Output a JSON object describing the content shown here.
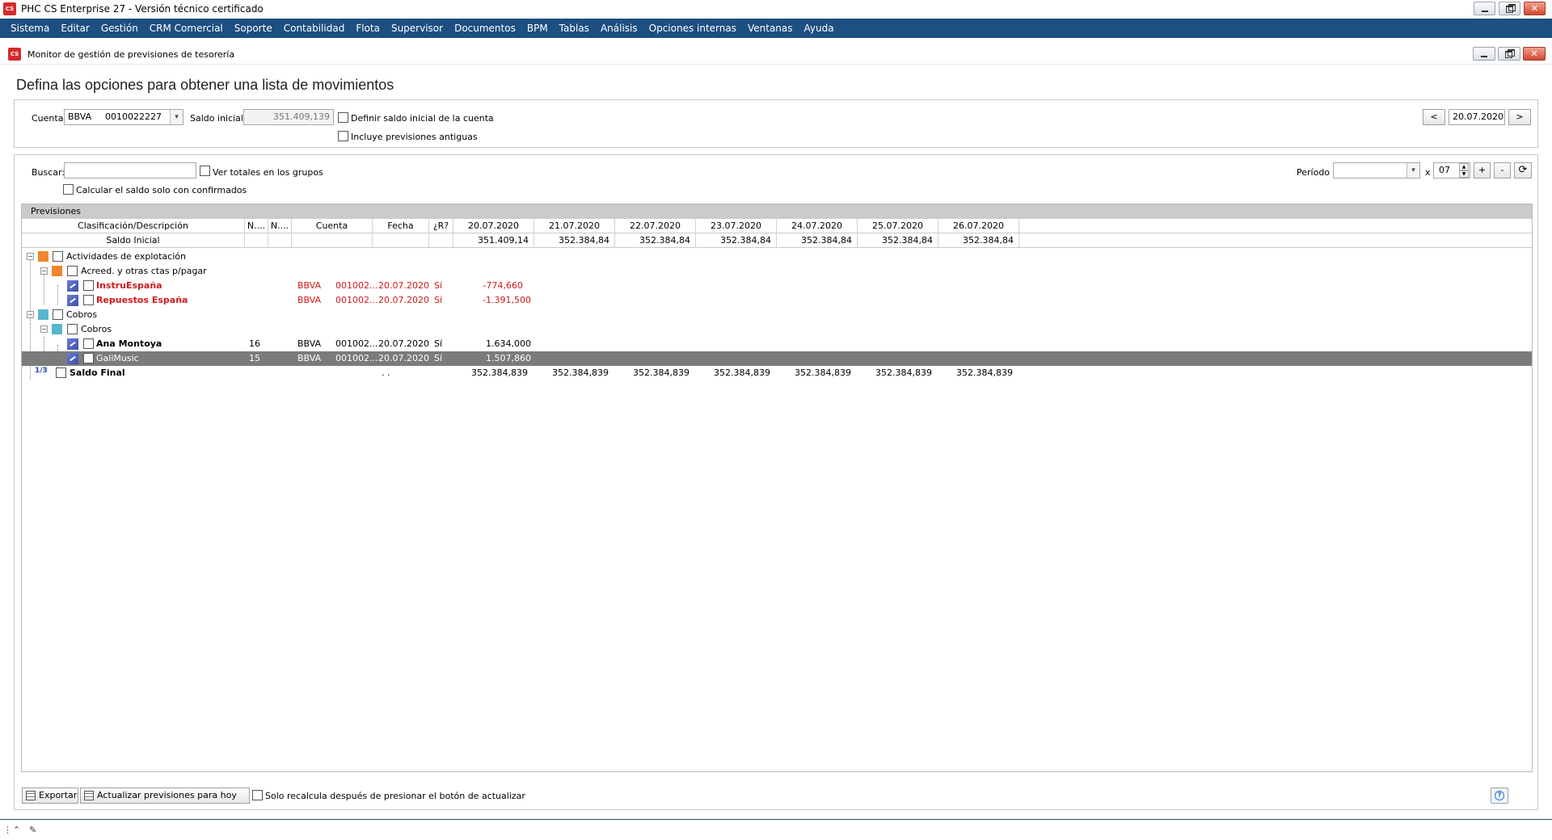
{
  "app": {
    "logo": "CS",
    "title": "PHC CS Enterprise 27 - Versión técnico certificado"
  },
  "menu": [
    "Sistema",
    "Editar",
    "Gestión",
    "CRM Comercial",
    "Soporte",
    "Contabilidad",
    "Flota",
    "Supervisor",
    "Documentos",
    "BPM",
    "Tablas",
    "Análisis",
    "Opciones internas",
    "Ventanas",
    "Ayuda"
  ],
  "window": {
    "title": "Monitor de gestión de previsiones de tesorería",
    "heading": "Defina las opciones para obtener una lista de movimientos"
  },
  "options": {
    "cuenta_label": "Cuenta",
    "cuenta_banco": "BBVA",
    "cuenta_numero": "0010022227",
    "saldo_label": "Saldo inicial",
    "saldo_value": "351.409,139",
    "definir_label": "Definir saldo inicial de la cuenta",
    "incluye_label": "Incluye previsiones antiguas",
    "fecha": "20.07.2020",
    "prev_label": "<",
    "next_label": ">"
  },
  "filters": {
    "buscar_label": "Buscar:",
    "ver_totales_label": "Ver totales en los grupos",
    "calcular_label": "Calcular el saldo solo con confirmados",
    "periodo_label": "Período",
    "x_label": "x",
    "periodo_num": "07",
    "plus_label": "+",
    "minus_label": "-"
  },
  "grid": {
    "caption": "Previsiones",
    "headers": [
      "Clasificación/Descripción",
      "N....",
      "N....",
      "Cuenta",
      "Fecha",
      "¿R?",
      "20.07.2020",
      "21.07.2020",
      "22.07.2020",
      "23.07.2020",
      "24.07.2020",
      "25.07.2020",
      "26.07.2020"
    ],
    "saldo_inicial_label": "Saldo Inicial",
    "saldo_inicial": [
      "351.409,14",
      "352.384,84",
      "352.384,84",
      "352.384,84",
      "352.384,84",
      "352.384,84",
      "352.384,84"
    ],
    "rows": [
      {
        "label": "Actividades de explotación"
      },
      {
        "label": "Acreed. y otras ctas p/pagar"
      },
      {
        "label": "InstruEspaña",
        "n1": "",
        "cuenta": "BBVA",
        "cuenta_num": "001002...",
        "fecha": "20.07.2020",
        "r": "Sí",
        "v1": "-774,660"
      },
      {
        "label": "Repuestos España",
        "n1": "",
        "cuenta": "BBVA",
        "cuenta_num": "001002...",
        "fecha": "20.07.2020",
        "r": "Sí",
        "v1": "-1.391,500"
      },
      {
        "label": "Cobros"
      },
      {
        "label": "Cobros"
      },
      {
        "label": "Ana Montoya",
        "n1": "16",
        "cuenta": "BBVA",
        "cuenta_num": "001002...",
        "fecha": "20.07.2020",
        "r": "Sí",
        "v1": "1.634,000"
      },
      {
        "label": "GaliMusic",
        "n1": "15",
        "cuenta": "BBVA",
        "cuenta_num": "001002...",
        "fecha": "20.07.2020",
        "r": "Sí",
        "v1": "1.507,860"
      }
    ],
    "saldo_final_label": "Saldo Final",
    "saldo_final_fecha": ". .",
    "saldo_final": [
      "352.384,839",
      "352.384,839",
      "352.384,839",
      "352.384,839",
      "352.384,839",
      "352.384,839",
      "352.384,839"
    ]
  },
  "footer": {
    "exportar": "Exportar",
    "actualizar": "Actualizar previsiones para hoy",
    "solo_label": "Solo recalcula después de presionar el botón de actualizar",
    "help": "?"
  },
  "colors": {
    "menu_bg": "#1d4f80",
    "negative": "#d11a1a",
    "selected_row": "#7b7b7b",
    "group1_icon": "#f0862a",
    "group2_icon": "#58b6cc"
  }
}
